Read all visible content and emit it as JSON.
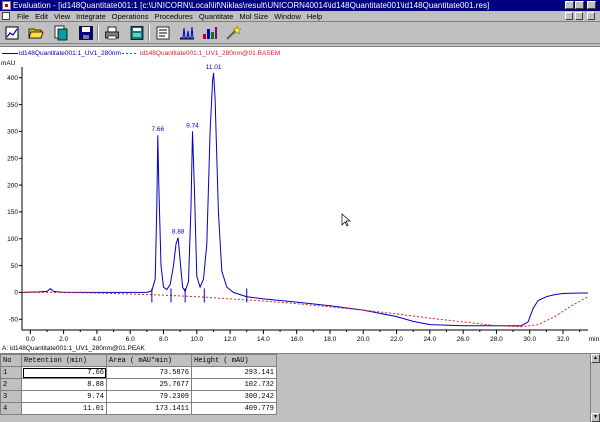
{
  "window": {
    "title": "Evaluation - [id148Quantitate001:1     [c:\\UNICORN\\Local\\lif\\Niklas\\result\\UNICORN40014\\id148Quantitate001\\id148Quantitate001.res]"
  },
  "menu": [
    "File",
    "Edit",
    "View",
    "Integrate",
    "Operations",
    "Procedures",
    "Quantitate",
    "Mol Size",
    "Window",
    "Help"
  ],
  "toolbar": {
    "icons": [
      "curve-select-icon",
      "open-folder-icon",
      "open-result-icon",
      "save-icon",
      "print-icon",
      "notes-icon",
      "copy-icon",
      "chromatogram-icon",
      "peak-table-icon",
      "integrate-icon"
    ]
  },
  "curves": {
    "uv_label": "id148Quantitate001:1_UV1_280nm",
    "baseline_label": "id148Quantitate001:1_UV1_280nm@01.BASEM"
  },
  "chart_data": {
    "type": "line",
    "y_unit": "mAU",
    "x_unit": "min",
    "xlim": [
      -0.5,
      33.5
    ],
    "ylim": [
      -70,
      420
    ],
    "x_ticks": [
      "0.0",
      "2.0",
      "4.0",
      "6.0",
      "8.0",
      "10.0",
      "12.0",
      "14.0",
      "16.0",
      "18.0",
      "20.0",
      "22.0",
      "24.0",
      "26.0",
      "28.0",
      "30.0",
      "32.0"
    ],
    "y_ticks": [
      "-50",
      "0",
      "50",
      "100",
      "150",
      "200",
      "250",
      "300",
      "350",
      "400"
    ],
    "peak_labels": [
      "7.66",
      "8.88",
      "9.74",
      "11.01"
    ],
    "series": [
      {
        "name": "id148Quantitate001:1_UV1_280nm",
        "color": "#0000c0",
        "x": [
          -0.5,
          0.5,
          1.0,
          1.2,
          1.4,
          2,
          3,
          4,
          5,
          6,
          7,
          7.3,
          7.5,
          7.6,
          7.66,
          7.72,
          7.85,
          8.0,
          8.2,
          8.4,
          8.6,
          8.75,
          8.88,
          9.0,
          9.15,
          9.3,
          9.5,
          9.65,
          9.74,
          9.85,
          10.0,
          10.2,
          10.4,
          10.6,
          10.8,
          10.95,
          11.01,
          11.1,
          11.3,
          11.5,
          11.8,
          12.2,
          13,
          14,
          16,
          18,
          20,
          22,
          23,
          24,
          26,
          28,
          29.5,
          29.9,
          30.2,
          30.5,
          31,
          31.5,
          32,
          33,
          33.5
        ],
        "y": [
          0,
          1,
          2,
          7,
          2,
          0,
          0,
          0,
          0,
          0,
          0,
          3,
          25,
          160,
          293,
          200,
          50,
          10,
          5,
          15,
          50,
          90,
          102,
          60,
          10,
          2,
          20,
          160,
          300,
          200,
          30,
          10,
          25,
          90,
          300,
          395,
          409,
          360,
          150,
          40,
          10,
          0,
          -8,
          -12,
          -18,
          -25,
          -33,
          -45,
          -54,
          -60,
          -62,
          -62,
          -62,
          -55,
          -30,
          -15,
          -8,
          -4,
          -2,
          -1,
          -1
        ]
      },
      {
        "name": "id148Quantitate001:1_UV1_280nm@01.BASEM",
        "color": "#e02020",
        "dashed": true,
        "x": [
          -0.5,
          2,
          4,
          6,
          8,
          10,
          12,
          14,
          16,
          18,
          20,
          22,
          24,
          26,
          28,
          29.5,
          30.5,
          31.5,
          32.5,
          33.5
        ],
        "y": [
          0,
          0,
          -1,
          -3,
          -5,
          -8,
          -12,
          -16,
          -21,
          -27,
          -33,
          -40,
          -48,
          -55,
          -62,
          -64,
          -60,
          -45,
          -25,
          -8
        ]
      }
    ]
  },
  "peak_table": {
    "header": "A: id148Quantitate001:1_UV1_280nm@01.PEAK",
    "columns": [
      "No",
      "Retention (min)",
      "Area ( mAU*min)",
      "Height ( mAU)"
    ],
    "rows": [
      {
        "no": "1",
        "retention": "7.66",
        "area": "73.5876",
        "height": "293.141"
      },
      {
        "no": "2",
        "retention": "8.88",
        "area": "25.7677",
        "height": "102.732"
      },
      {
        "no": "3",
        "retention": "9.74",
        "area": "79.2309",
        "height": "300.242"
      },
      {
        "no": "4",
        "retention": "11.01",
        "area": "173.1411",
        "height": "409.779"
      }
    ]
  }
}
